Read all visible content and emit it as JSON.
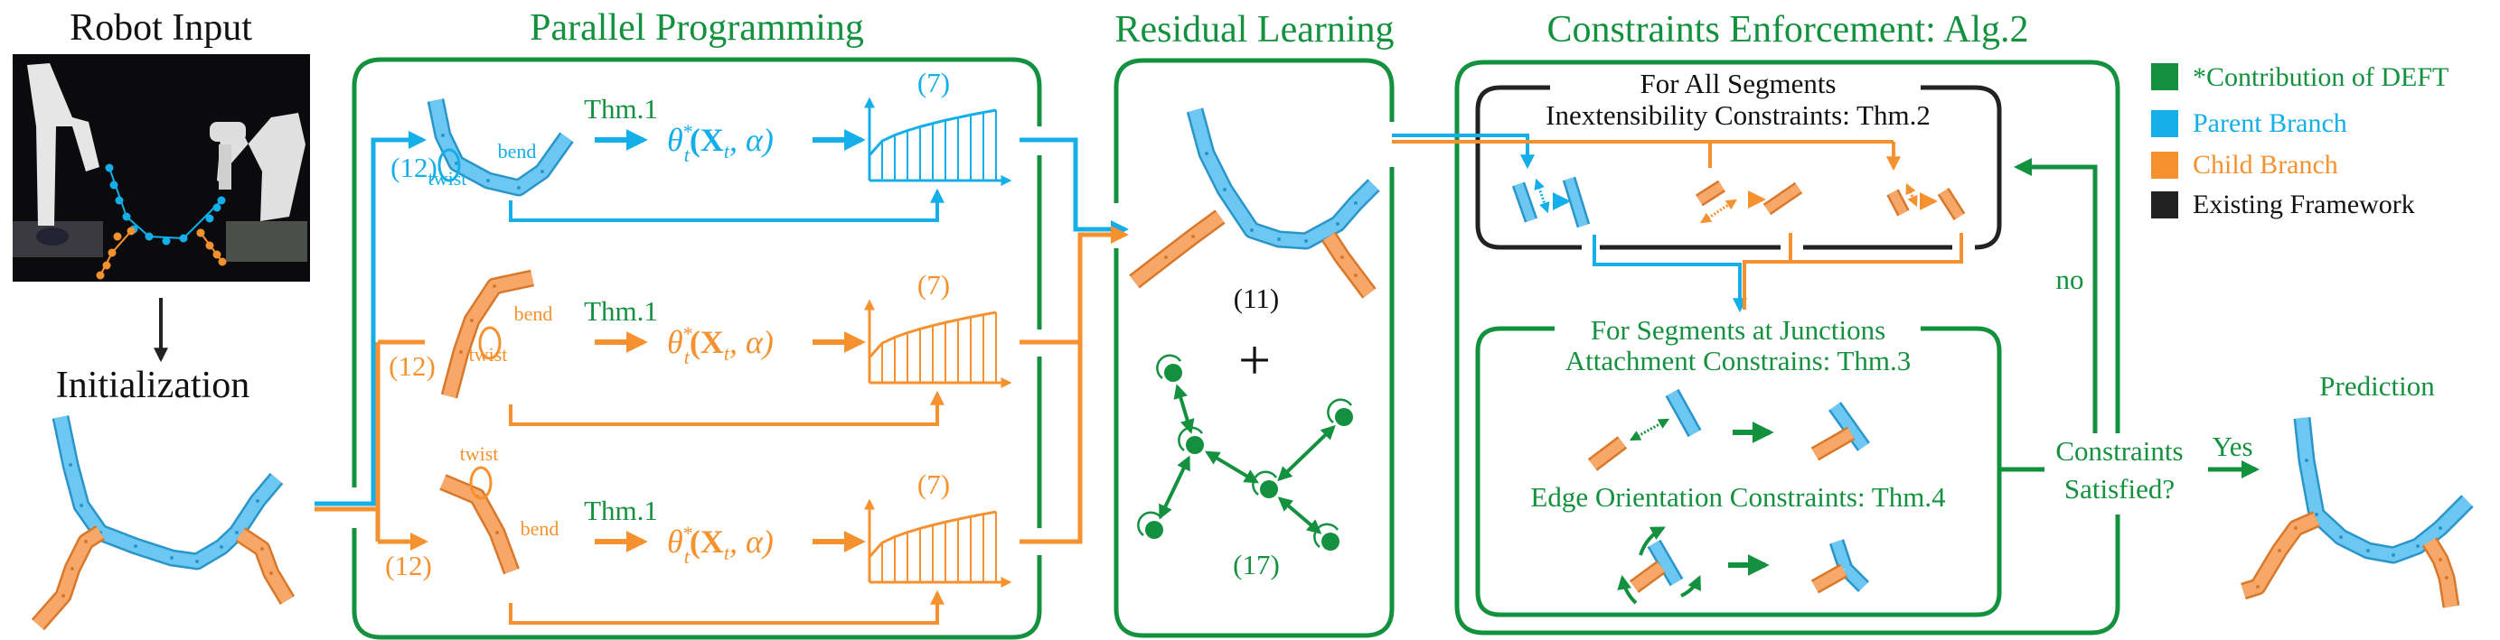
{
  "colors": {
    "green": "#14913f",
    "blue": "#14aee8",
    "orange": "#f5922f",
    "black": "#222222"
  },
  "sections": {
    "robot_input": "Robot Input",
    "initialization": "Initialization",
    "parallel_programming": "Parallel Programming",
    "residual_learning": "Residual Learning",
    "constraints_enforcement": "Constraints Enforcement: Alg.2",
    "prediction": "Prediction"
  },
  "parallel_rows": [
    {
      "branch": "parent",
      "eq": "(12)",
      "thm": "Thm.1",
      "theta": "θ",
      "theta_sup": "*",
      "theta_sub": "t",
      "theta_args": "(X",
      "theta_args_sub": "t",
      "theta_args_end": ", α)",
      "chart_eq": "(7)",
      "twist": "twist",
      "bend": "bend"
    },
    {
      "branch": "child",
      "eq": "(12)",
      "thm": "Thm.1",
      "theta": "θ",
      "theta_sup": "*",
      "theta_sub": "t",
      "theta_args": "(X",
      "theta_args_sub": "t",
      "theta_args_end": ", α)",
      "chart_eq": "(7)",
      "twist": "twist",
      "bend": "bend"
    },
    {
      "branch": "child",
      "eq": "(12)",
      "thm": "Thm.1",
      "theta": "θ",
      "theta_sup": "*",
      "theta_sub": "t",
      "theta_args": "(X",
      "theta_args_sub": "t",
      "theta_args_end": ", α)",
      "chart_eq": "(7)",
      "twist": "twist",
      "bend": "bend"
    }
  ],
  "residual": {
    "eq_top": "(11)",
    "plus": "+",
    "eq_bottom": "(17)"
  },
  "constraints": {
    "all_segments_title": "For All Segments",
    "inextensibility": "Inextensibility Constraints: Thm.2",
    "junctions_title": "For Segments at Junctions",
    "attachment": "Attachment Constrains: Thm.3",
    "edge_orientation": "Edge Orientation Constraints: Thm.4",
    "question_line1": "Constraints",
    "question_line2": "Satisfied?",
    "no": "no",
    "yes": "Yes"
  },
  "legend": [
    {
      "label": "*Contribution of DEFT",
      "color": "#14913f"
    },
    {
      "label": "Parent Branch",
      "color": "#14aee8"
    },
    {
      "label": "Child Branch",
      "color": "#f5922f"
    },
    {
      "label": "Existing Framework",
      "color": "#222222"
    }
  ]
}
